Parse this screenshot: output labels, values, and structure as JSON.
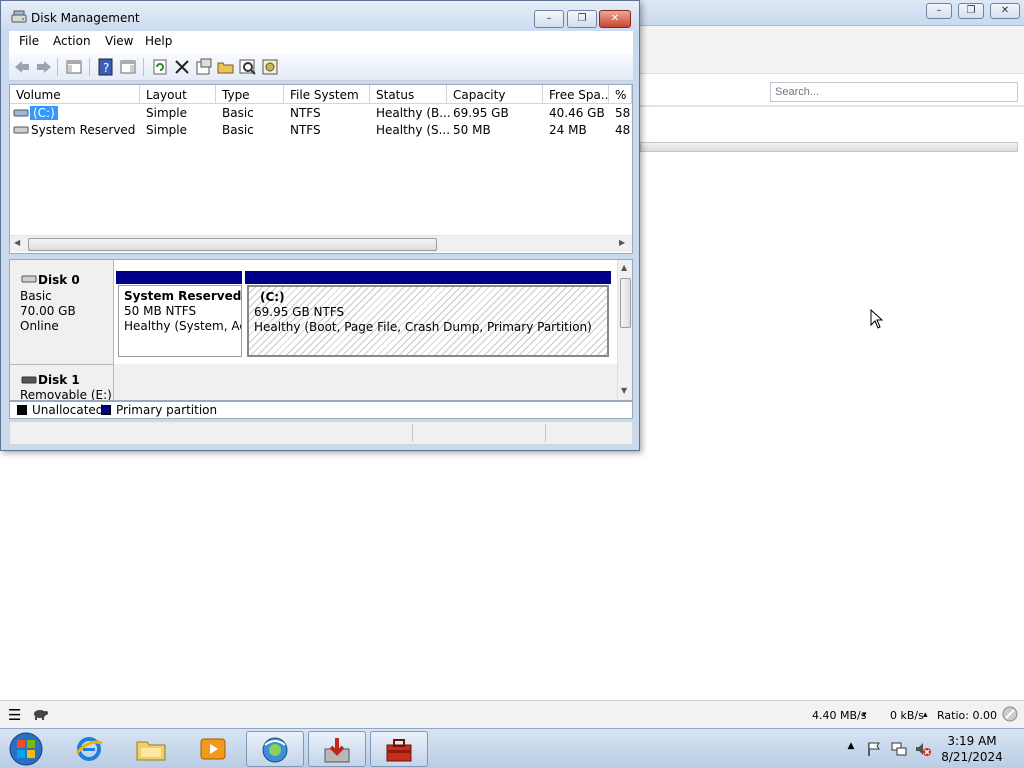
{
  "window": {
    "title": "Disk Management"
  },
  "menu": [
    "File",
    "Action",
    "View",
    "Help"
  ],
  "volume_table": {
    "columns": [
      "Volume",
      "Layout",
      "Type",
      "File System",
      "Status",
      "Capacity",
      "Free Spa...",
      "% F"
    ],
    "rows": [
      [
        "(C:)",
        "Simple",
        "Basic",
        "NTFS",
        "Healthy (B...",
        "69.95 GB",
        "40.46 GB",
        "58"
      ],
      [
        "System Reserved",
        "Simple",
        "Basic",
        "NTFS",
        "Healthy (S...",
        "50 MB",
        "24 MB",
        "48"
      ]
    ]
  },
  "disk0": {
    "name": "Disk 0",
    "type": "Basic",
    "size": "70.00 GB",
    "state": "Online",
    "partitions": [
      {
        "title": "System Reserved",
        "detail": "50 MB NTFS",
        "status": "Healthy (System, Acti"
      },
      {
        "title": "(C:)",
        "detail": "69.95 GB NTFS",
        "status": "Healthy (Boot, Page File, Crash Dump, Primary Partition)"
      }
    ]
  },
  "disk1": {
    "name": "Disk 1",
    "type": "Removable (E:)"
  },
  "legend": {
    "unallocated": "Unallocated",
    "primary": "Primary partition",
    "colors": {
      "unallocated": "#000000",
      "primary": "#00008b"
    }
  },
  "background_app": {
    "search_placeholder": "Search...",
    "down_speed": "4.40 MB/s",
    "up_speed": "0 kB/s",
    "ratio": "Ratio: 0.00",
    "down_arrow": "▾",
    "up_arrow": "▴"
  },
  "clock": {
    "time": "3:19 AM",
    "date": "8/21/2024"
  },
  "icons": {
    "title_icon": "disk-management-icon",
    "taskbar": [
      "start-orb",
      "internet-explorer",
      "file-explorer",
      "media-player",
      "network-app",
      "download-app",
      "toolbox-app"
    ],
    "tray": [
      "show-hidden-icons",
      "action-center-flag",
      "network",
      "volume-muted"
    ]
  }
}
